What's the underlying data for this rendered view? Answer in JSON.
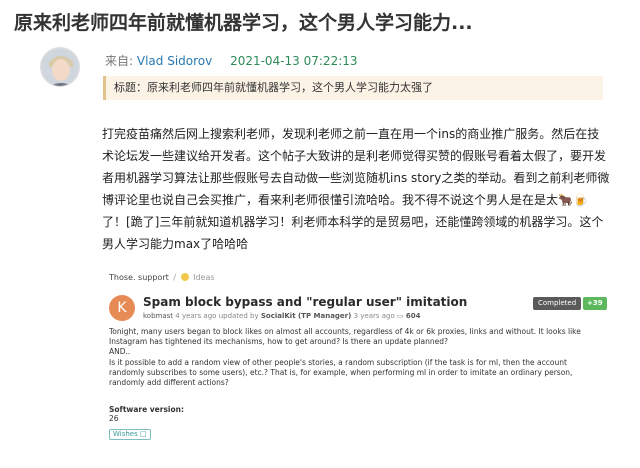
{
  "title": "原来利老师四年前就懂机器学习，这个男人学习能力...",
  "meta": {
    "from_label": "来自:",
    "author": "Vlad Sidorov",
    "date": "2021-04-13 07:22:13"
  },
  "quote": "标题：原来利老师四年前就懂机器学习，这个男人学习能力太强了",
  "article": "打完疫苗痛然后网上搜索利老师，发现利老师之前一直在用一个ins的商业推广服务。然后在技术论坛发一些建议给开发者。这个帖子大致讲的是利老师觉得买赞的假账号看着太假了，要开发者用机器学习算法让那些假账号去自动做一些浏览随机ins story之类的举动。看到之前利老师微博评论里也说自己会买推广，看来利老师很懂引流哈哈。我不得不说这个男人是在是太🐂🍺了！[跪了]三年前就知道机器学习！利老师本科学的是贸易吧，还能懂跨领域的机器学习。这个男人学习能力max了哈哈哈",
  "card": {
    "crumb_site": "Those. support",
    "crumb_sep": "/",
    "crumb_section": "Ideas",
    "avatar_letter": "K",
    "post_title": "Spam block bypass and \"regular user\" imitation",
    "author": "kobmast",
    "posted": "4 years ago",
    "updated_label": "updated by",
    "updater": "SocialKit (TP Manager)",
    "updated_ago": "3 years ago",
    "comments": "604",
    "status": "Completed",
    "votes": "+39",
    "body": [
      "Tonight, many users began to block likes on almost all accounts, regardless of 4k or 6k proxies, links and without. It looks like Instagram has tightened its mechanisms, how to get around? Is there an update planned?",
      "AND..",
      "Is it possible to add a random view of other people's stories, a random subscription (if the task is for ml, then the account randomly subscribes to some users), etc.? That is, for example, when performing ml in order to imitate an ordinary person, randomly add different actions?"
    ],
    "software_label": "Software version:",
    "software_value": "26",
    "tag": "Wishes",
    "colors": {
      "avatar": "#e78b56",
      "completed": "#5a5a5a",
      "votes": "#5cb85c",
      "tag": "#3a9a9a"
    }
  },
  "colors": {
    "author_link": "#2a7ab0",
    "date": "#2e8b57",
    "quote_bg": "#fbf3e6",
    "quote_border": "#e1c28b"
  }
}
